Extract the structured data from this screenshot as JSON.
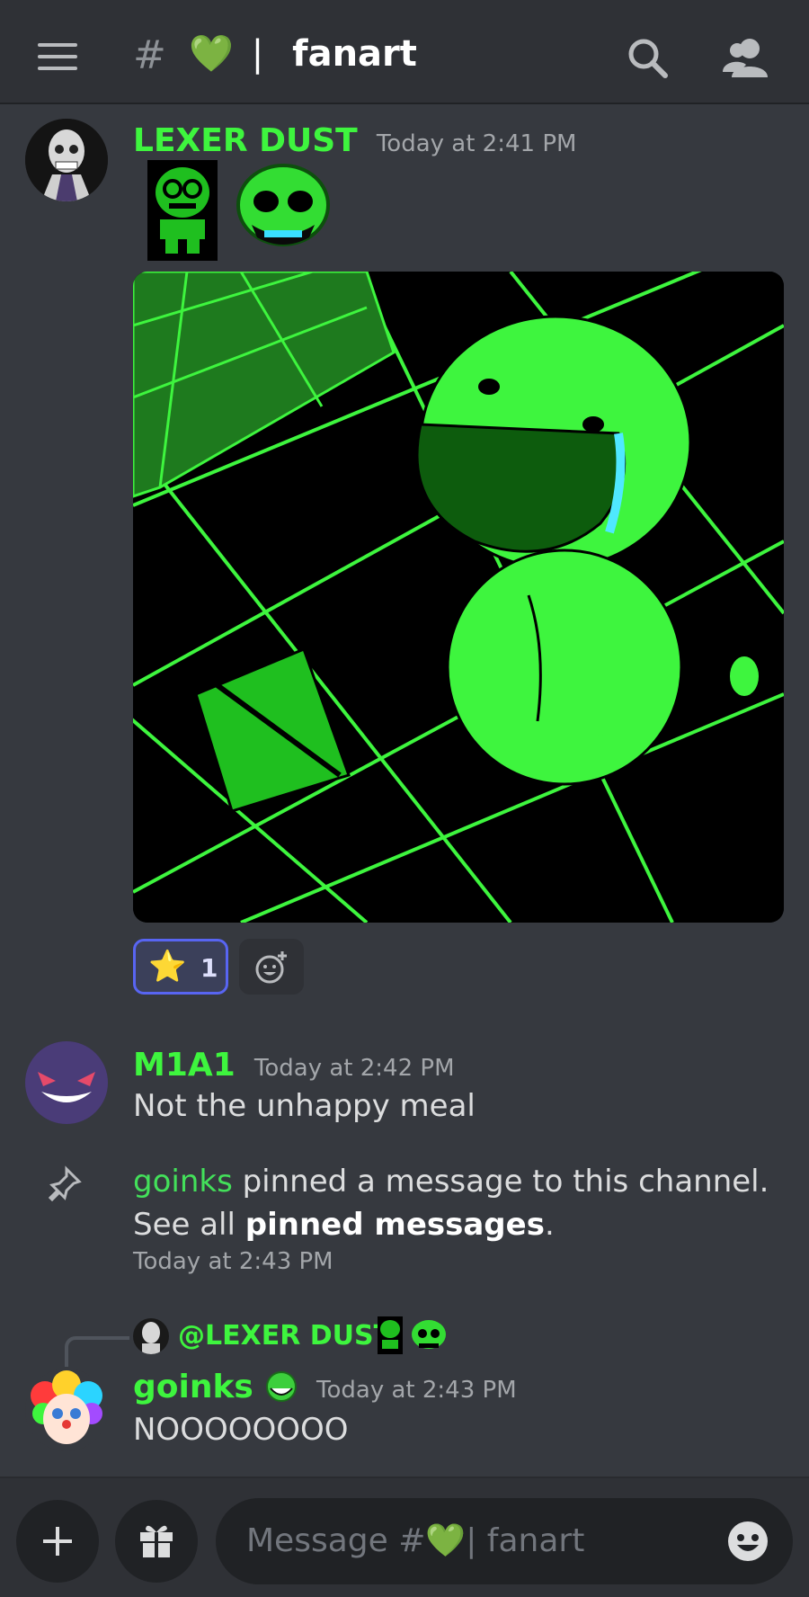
{
  "header": {
    "hash": "#",
    "heart": "💚",
    "divider": "|",
    "channel": "fanart"
  },
  "messages": [
    {
      "author": "LEXER DUST",
      "author_color": "#3ef53e",
      "timestamp": "Today at 2:41 PM",
      "reaction": {
        "emoji": "⭐",
        "count": "1"
      }
    },
    {
      "author": "M1A1",
      "author_color": "#3ef53e",
      "timestamp": "Today at 2:42 PM",
      "text": "Not the unhappy meal"
    }
  ],
  "pin_notice": {
    "user": "goinks",
    "text": " pinned a message to this channel. See all ",
    "link": "pinned messages",
    "end": ".",
    "timestamp": "Today at 2:43 PM"
  },
  "reply": {
    "reply_to": "@LEXER DUST",
    "author": "goinks",
    "timestamp": "Today at 2:43 PM",
    "text": "NOOOOOOOO"
  },
  "input": {
    "placeholder": "Message #💚|  fanart"
  },
  "colors": {
    "accent": "#5865f2",
    "green": "#3ef53e",
    "bg": "#36393f"
  }
}
